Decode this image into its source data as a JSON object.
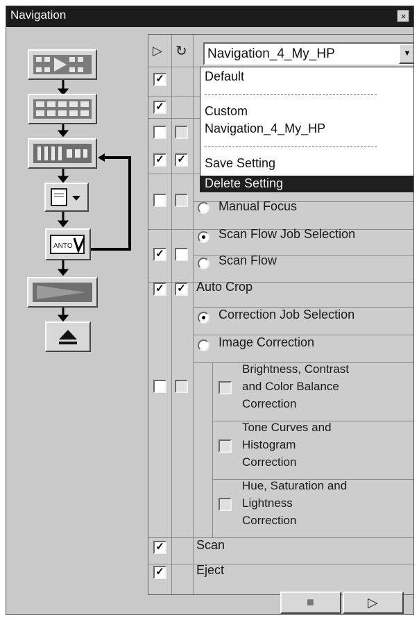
{
  "window": {
    "title": "Navigation",
    "close_icon": "×"
  },
  "header": {
    "play_icon": "▷",
    "refresh_icon": "↻"
  },
  "combo": {
    "selected": "Navigation_4_My_HP"
  },
  "dropdown": {
    "items": [
      "Default",
      "Custom",
      "Navigation_4_My_HP",
      "Save Setting",
      "Delete Setting"
    ],
    "highlighted": "Delete Setting"
  },
  "rows": {
    "manual_focus": "Manual Focus",
    "scan_flow_job": "Scan Flow Job Selection",
    "scan_flow": "Scan Flow",
    "auto_crop": "Auto Crop",
    "correction_job": "Correction Job Selection",
    "image_correction": "Image Correction",
    "brightness": [
      "Brightness, Contrast",
      "and Color Balance",
      "Correction"
    ],
    "tone": [
      "Tone Curves and",
      "Histogram",
      "Correction"
    ],
    "hue": [
      "Hue, Saturation and",
      "Lightness",
      "Correction"
    ],
    "scan": "Scan",
    "eject": "Eject"
  },
  "checks": {
    "mark": "✓"
  },
  "buttons": {
    "stop_icon": "■",
    "play_icon": "▷"
  },
  "flow_buttons": {
    "film_text": "ANTO",
    "eject_icon": "⏏"
  }
}
